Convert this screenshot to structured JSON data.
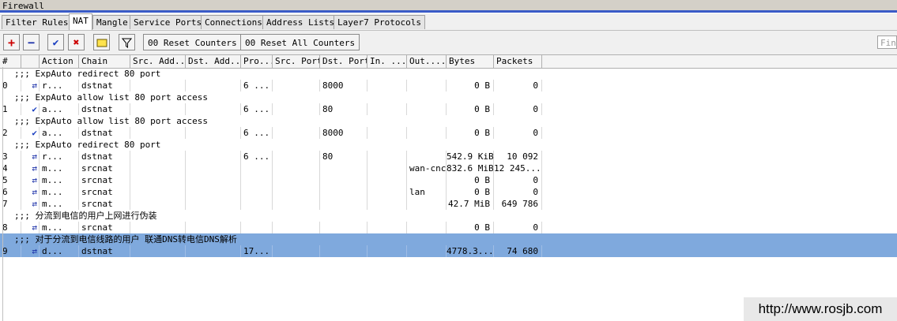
{
  "window": {
    "title": "Firewall"
  },
  "tabs": [
    "Filter Rules",
    "NAT",
    "Mangle",
    "Service Ports",
    "Connections",
    "Address Lists",
    "Layer7 Protocols"
  ],
  "active_tab": "NAT",
  "toolbar": {
    "add": "+",
    "remove": "−",
    "enable": "✔",
    "disable": "✖",
    "comment": "▭",
    "filter": "⊻",
    "reset_counters": "00 Reset Counters",
    "reset_all_counters": "00 Reset All Counters",
    "find_placeholder": "Find"
  },
  "columns": [
    "#",
    "",
    "Action",
    "Chain",
    "Src. Add...",
    "Dst. Add...",
    "Pro...",
    "Src. Port",
    "Dst. Port",
    "In. ...",
    "Out....",
    "Bytes",
    "Packets"
  ],
  "rows": [
    {
      "type": "comment",
      "text": ";;; ExpAuto redirect 80 port"
    },
    {
      "type": "rule",
      "num": "0",
      "icon": "⇄",
      "action": "r...",
      "chain": "dstnat",
      "proto": "6 ...",
      "dport": "8000",
      "out": "",
      "bytes": "0 B",
      "packets": "0"
    },
    {
      "type": "comment",
      "text": ";;; ExpAuto allow list 80 port access"
    },
    {
      "type": "rule",
      "num": "1",
      "icon": "✔",
      "action": "a...",
      "chain": "dstnat",
      "proto": "6 ...",
      "dport": "80",
      "out": "",
      "bytes": "0 B",
      "packets": "0"
    },
    {
      "type": "comment",
      "text": ";;; ExpAuto allow list 80 port access"
    },
    {
      "type": "rule",
      "num": "2",
      "icon": "✔",
      "action": "a...",
      "chain": "dstnat",
      "proto": "6 ...",
      "dport": "8000",
      "out": "",
      "bytes": "0 B",
      "packets": "0"
    },
    {
      "type": "comment",
      "text": ";;; ExpAuto redirect 80 port"
    },
    {
      "type": "rule",
      "num": "3",
      "icon": "⇄",
      "action": "r...",
      "chain": "dstnat",
      "proto": "6 ...",
      "dport": "80",
      "out": "",
      "bytes": "542.9 KiB",
      "packets": "10 092"
    },
    {
      "type": "rule",
      "num": "4",
      "icon": "⇄",
      "action": "m...",
      "chain": "srcnat",
      "proto": "",
      "dport": "",
      "out": "wan-cnc",
      "bytes": "832.6 MiB",
      "packets": "12 245..."
    },
    {
      "type": "rule",
      "num": "5",
      "icon": "⇄",
      "action": "m...",
      "chain": "srcnat",
      "proto": "",
      "dport": "",
      "out": "",
      "bytes": "0 B",
      "packets": "0"
    },
    {
      "type": "rule",
      "num": "6",
      "icon": "⇄",
      "action": "m...",
      "chain": "srcnat",
      "proto": "",
      "dport": "",
      "out": "lan",
      "bytes": "0 B",
      "packets": "0"
    },
    {
      "type": "rule",
      "num": "7",
      "icon": "⇄",
      "action": "m...",
      "chain": "srcnat",
      "proto": "",
      "dport": "",
      "out": "",
      "bytes": "42.7 MiB",
      "packets": "649 786"
    },
    {
      "type": "comment",
      "text": ";;; 分流到电信的用户上网进行伪装"
    },
    {
      "type": "rule",
      "num": "8",
      "icon": "⇄",
      "action": "m...",
      "chain": "srcnat",
      "proto": "",
      "dport": "",
      "out": "",
      "bytes": "0 B",
      "packets": "0"
    },
    {
      "type": "comment",
      "text": ";;; 对于分流到电信线路的用户 联通DNS转电信DNS解析",
      "selected": true
    },
    {
      "type": "rule",
      "num": "9",
      "icon": "⇄",
      "action": "d...",
      "chain": "dstnat",
      "proto": "17...",
      "dport": "",
      "out": "",
      "bytes": "4778.3...",
      "packets": "74 680",
      "selected": true
    }
  ],
  "watermark": "http://www.rosjb.com"
}
